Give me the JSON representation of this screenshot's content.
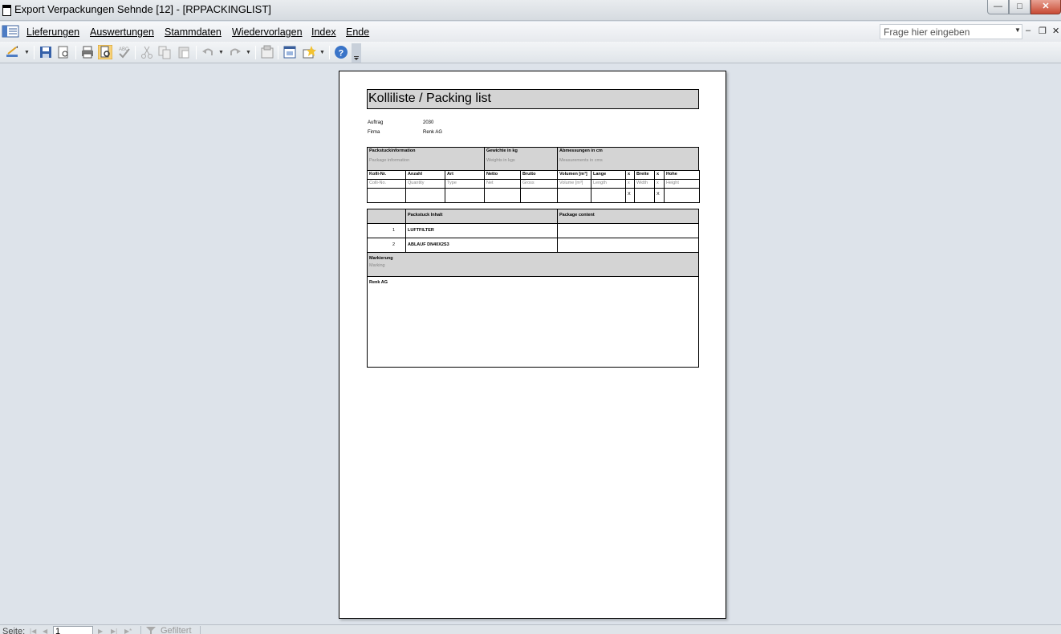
{
  "window": {
    "title": "Export Verpackungen Sehnde [12] - [RPPACKINGLIST]",
    "min": "—",
    "max": "□",
    "close": "✕"
  },
  "menu": {
    "items": [
      "Lieferungen",
      "Auswertungen",
      "Stammdaten",
      "Wiedervorlagen",
      "Index",
      "Ende"
    ],
    "help_placeholder": "Frage hier eingeben",
    "mdi_min": "–",
    "mdi_restore": "❐",
    "mdi_close": "✕"
  },
  "report": {
    "title": "Kolliliste / Packing list",
    "auftrag_label": "Auftrag",
    "auftrag_value": "2030",
    "firma_label": "Firma",
    "firma_value": "Renk AG",
    "sections": {
      "package_info": "Packstuckinformation",
      "package_info_en": "Package information",
      "weights": "Gewichte in kg",
      "weights_en": "Weights in kgs",
      "dimensions": "Abmessungen in cm",
      "dimensions_en": "Measurements in cms"
    },
    "columns": [
      {
        "de": "Kolli-Nr.",
        "en": "Colli-No."
      },
      {
        "de": "Anzahl",
        "en": "Quantity"
      },
      {
        "de": "Art",
        "en": "Type"
      },
      {
        "de": "Netto",
        "en": "Net"
      },
      {
        "de": "Brutto",
        "en": "Gross"
      },
      {
        "de": "Volumen [m³]",
        "en": "Volume [m³]"
      },
      {
        "de": "Lange",
        "en": "Length"
      },
      {
        "de": "x",
        "en": "x"
      },
      {
        "de": "Breite",
        "en": "Width"
      },
      {
        "de": "x",
        "en": "x"
      },
      {
        "de": "Hohe",
        "en": "Height"
      }
    ],
    "data_row_x1": "X",
    "data_row_x2": "X",
    "content_header_de": "Packstuck Inhalt",
    "content_header_en": "Package content",
    "content_rows": [
      {
        "no": "1",
        "text": "LUFTFILTER"
      },
      {
        "no": "2",
        "text": "ABLAUF DN40X2S3"
      }
    ],
    "marking_label": "Markierung",
    "marking_label_en": "Marking",
    "marking_value": "Renk AG"
  },
  "status": {
    "page_label": "Seite:",
    "page_value": "1",
    "filter_label": "Gefiltert"
  }
}
